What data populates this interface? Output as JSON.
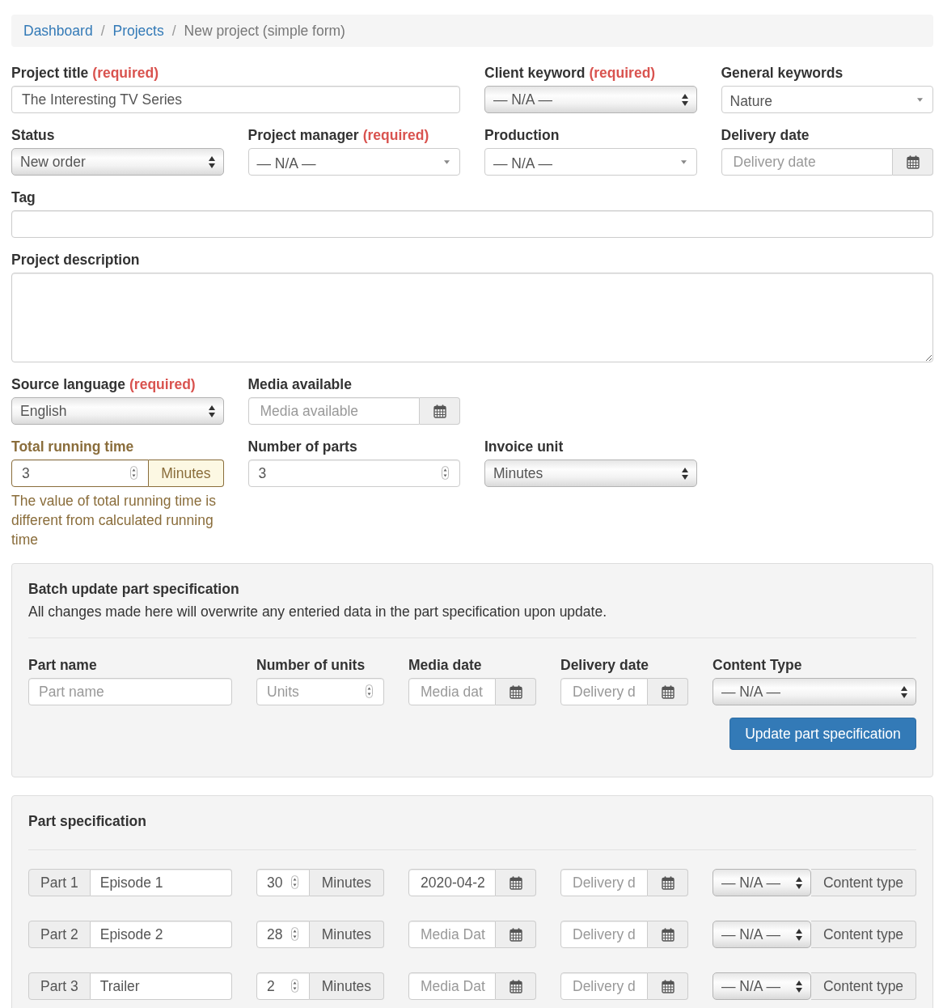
{
  "breadcrumb": [
    {
      "kind": "link",
      "label": "Dashboard"
    },
    {
      "kind": "separator",
      "label": "/"
    },
    {
      "kind": "link",
      "label": "Projects"
    },
    {
      "kind": "separator",
      "label": "/"
    },
    {
      "kind": "current",
      "label": "New project (simple form)"
    }
  ],
  "form_rows": [
    [
      {
        "label": "Project title",
        "required_note": "(required)",
        "kind": "text",
        "value": "The Interesting TV Series"
      },
      {
        "label": "Client keyword",
        "required_note": "(required)",
        "kind": "native-select",
        "value": "— N/A —"
      },
      {
        "label": "General keywords",
        "kind": "custom-select",
        "value": "Nature"
      }
    ],
    [
      {
        "label": "Status",
        "kind": "native-select",
        "value": "New order"
      },
      {
        "label": "Project manager",
        "required_note": "(required)",
        "kind": "custom-select",
        "value": "— N/A —"
      },
      {
        "label": "Production",
        "kind": "custom-select",
        "value": "— N/A —"
      },
      {
        "label": "Delivery date",
        "kind": "date",
        "placeholder": "Delivery date"
      }
    ],
    [
      {
        "label": "Tag",
        "kind": "text"
      }
    ],
    [
      {
        "label": "Project description",
        "kind": "textarea"
      }
    ],
    [
      {
        "label": "Source language",
        "required_note": "(required)",
        "kind": "native-select",
        "value": "English"
      },
      {
        "label": "Media available",
        "kind": "date",
        "placeholder": "Media available"
      }
    ],
    [
      {
        "label": "Total running time",
        "kind": "number",
        "value": "3",
        "addon": "Minutes",
        "warning": true,
        "help": "The value of total running time is different from calculated running time"
      },
      {
        "label": "Number of parts",
        "kind": "number",
        "value": "3",
        "warning": false
      },
      {
        "label": "Invoice unit",
        "kind": "native-select",
        "value": "Minutes"
      }
    ]
  ],
  "batch_update": {
    "title": "Batch update part specification",
    "description": "All changes made here will overwrite any enteried data in the part specification upon update.",
    "fields": [
      {
        "label": "Part name",
        "kind": "text",
        "placeholder": "Part name"
      },
      {
        "label": "Number of units",
        "kind": "number",
        "placeholder": "Units"
      },
      {
        "label": "Media date",
        "kind": "date",
        "placeholder": "Media dat"
      },
      {
        "label": "Delivery date",
        "kind": "date",
        "placeholder": "Delivery d"
      },
      {
        "label": "Content Type",
        "kind": "native-select",
        "value": "— N/A —"
      }
    ],
    "button": "Update part specification"
  },
  "part_specification": {
    "title": "Part specification",
    "parts": [
      {
        "part_label": "Part 1",
        "name": "Episode 1",
        "units": "30",
        "unit_label": "Minutes",
        "media_date": {
          "value": "2020-04-2"
        },
        "delivery_date": {
          "placeholder": "Delivery d"
        },
        "content_type": "— N/A —",
        "content_type_label": "Content type"
      },
      {
        "part_label": "Part 2",
        "name": "Episode 2",
        "units": "28",
        "unit_label": "Minutes",
        "media_date": {
          "placeholder": "Media Dat"
        },
        "delivery_date": {
          "placeholder": "Delivery d"
        },
        "content_type": "— N/A —",
        "content_type_label": "Content type"
      },
      {
        "part_label": "Part 3",
        "name": "Trailer",
        "units": "2",
        "unit_label": "Minutes",
        "media_date": {
          "placeholder": "Media Dat"
        },
        "delivery_date": {
          "placeholder": "Delivery d"
        },
        "content_type": "— N/A —",
        "content_type_label": "Content type"
      }
    ]
  }
}
